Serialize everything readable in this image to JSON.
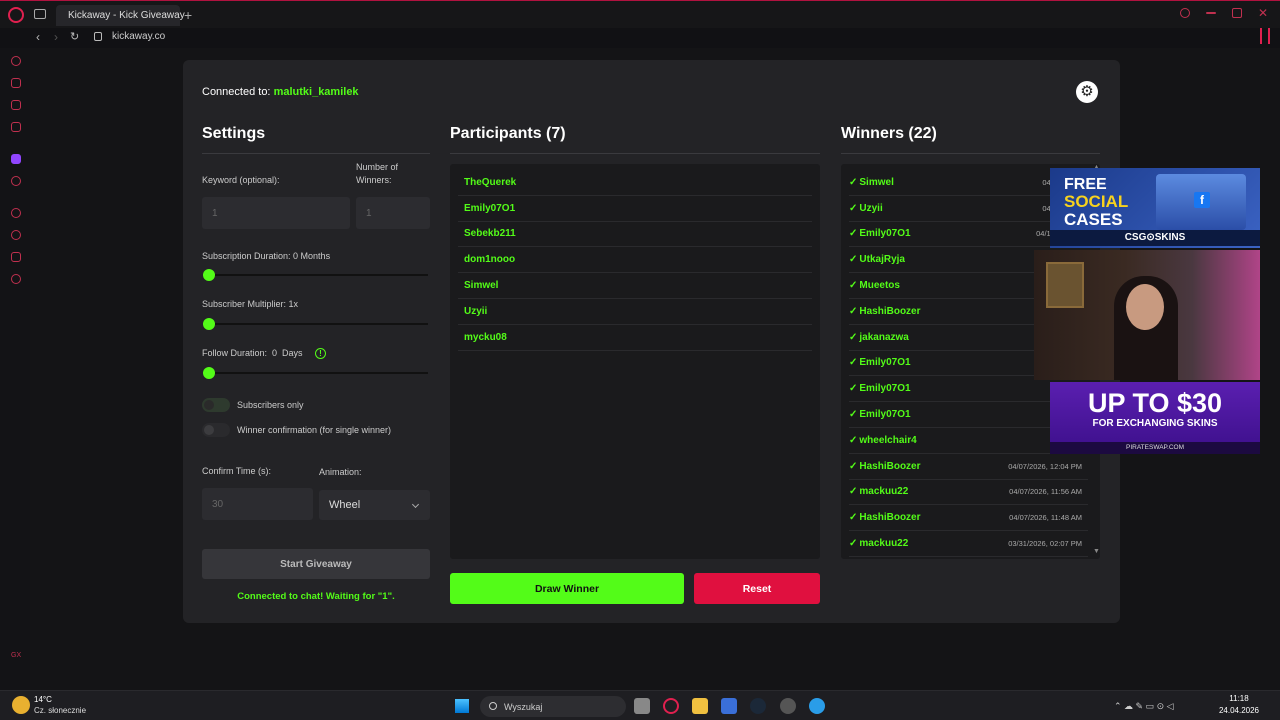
{
  "browser": {
    "tab_title": "Kickaway - Kick Giveaway",
    "url": "kickaway.co",
    "sidebar_footer": "GX"
  },
  "header": {
    "connected_label": "Connected to:",
    "channel": "malutki_kamilek"
  },
  "settings": {
    "title": "Settings",
    "keyword_label": "Keyword (optional):",
    "keyword_placeholder": "1",
    "winners_label": "Number of Winners:",
    "winners_placeholder": "1",
    "subscription_label": "Subscription Duration: 0 Months",
    "subscription_value": 0,
    "multiplier_label": "Subscriber Multiplier: 1x",
    "multiplier_value": 0,
    "follow_label": "Follow Duration:  0  Days",
    "follow_value": 0,
    "subscribers_only_label": "Subscribers only",
    "winner_confirmation_label": "Winner confirmation (for single winner)",
    "confirm_time_label": "Confirm Time (s):",
    "confirm_time_placeholder": "30",
    "animation_label": "Animation:",
    "animation_value": "Wheel",
    "start_button": "Start Giveaway",
    "chat_status": "Connected to chat! Waiting for \"1\"."
  },
  "participants": {
    "title": "Participants (7)",
    "items": [
      "TheQuerek",
      "Emily07O1",
      "Sebekb211",
      "dom1nooo",
      "Simwel",
      "Uzyii",
      "mycku08"
    ]
  },
  "winners": {
    "title": "Winners (22)",
    "items": [
      {
        "name": "Simwel",
        "date": "04/17/2026,"
      },
      {
        "name": "Uzyii",
        "date": "04/17/2026,"
      },
      {
        "name": "Emily07O1",
        "date": "04/14/2026, 0"
      },
      {
        "name": "UtkajRyja",
        "date": "04/13/2"
      },
      {
        "name": "Mueetos",
        "date": "04/13/2"
      },
      {
        "name": "HashiBoozer",
        "date": "04/13/2"
      },
      {
        "name": "jakanazwa",
        "date": "04/10/2"
      },
      {
        "name": "Emily07O1",
        "date": "04/10/"
      },
      {
        "name": "Emily07O1",
        "date": "04/1"
      },
      {
        "name": "Emily07O1",
        "date": "04/08"
      },
      {
        "name": "wheelchair4",
        "date": "04/07"
      },
      {
        "name": "HashiBoozer",
        "date": "04/07/2026, 12:04 PM"
      },
      {
        "name": "mackuu22",
        "date": "04/07/2026, 11:56 AM"
      },
      {
        "name": "HashiBoozer",
        "date": "04/07/2026, 11:48 AM"
      },
      {
        "name": "mackuu22",
        "date": "03/31/2026, 02:07 PM"
      }
    ]
  },
  "actions": {
    "draw": "Draw Winner",
    "reset": "Reset"
  },
  "overlay": {
    "ad1_line1": "FREE",
    "ad1_line2": "SOCIAL",
    "ad1_line3": "CASES",
    "ad1_brand": "CSG⊙SKINS",
    "ad2_big": "UP TO $30",
    "ad2_small": "FOR EXCHANGING SKINS",
    "ad2_foot": "PIRATESWAP.COM"
  },
  "taskbar": {
    "temperature": "14°C",
    "weather": "Cz. słonecznie",
    "search_placeholder": "Wyszukaj",
    "time": "11:18",
    "date": "24.04.2026"
  },
  "colors": {
    "accent": "#53fc18",
    "danger": "#e0103f",
    "card": "#232326"
  }
}
